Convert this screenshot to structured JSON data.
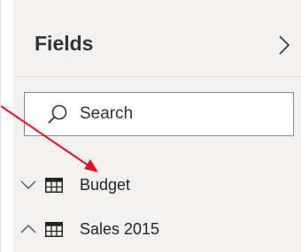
{
  "panel": {
    "title": "Fields"
  },
  "search": {
    "placeholder": "Search"
  },
  "fields": [
    {
      "label": "Budget",
      "expanded": false,
      "icon": "table-icon"
    },
    {
      "label": "Sales 2015",
      "expanded": true,
      "icon": "table-icon"
    }
  ],
  "annotation": {
    "arrow_color": "#e81123"
  },
  "colors": {
    "pane_background": "#f3f2f1",
    "text": "#333333"
  }
}
